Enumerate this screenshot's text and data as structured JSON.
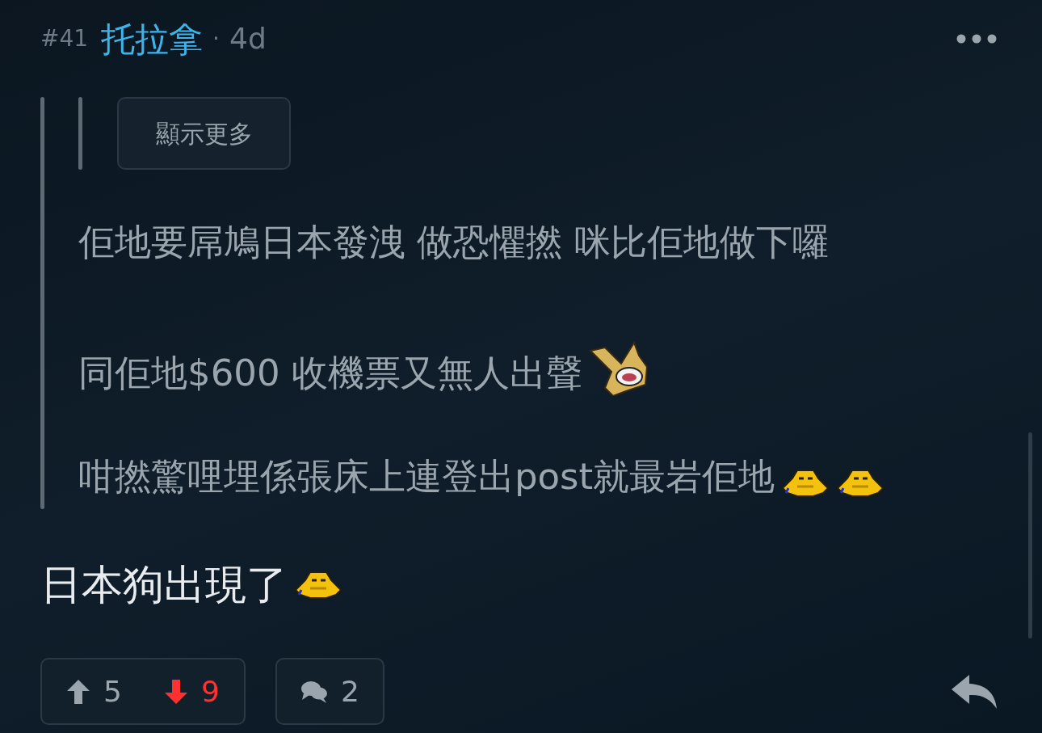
{
  "post": {
    "number": "#41",
    "author": "托拉拿",
    "separator": "·",
    "age": "4d"
  },
  "quote": {
    "show_more": "顯示更多",
    "lines": [
      {
        "text": "佢地要屌鳩日本發洩 做恐懼撚 咪比佢地做下囉"
      },
      {
        "text": "同佢地$600 收機票又無人出聲",
        "stickers": [
          {
            "kind": "horn"
          }
        ]
      },
      {
        "text": "咁撚驚哩埋係張床上連登出post就最岩佢地",
        "stickers": [
          {
            "kind": "cry"
          },
          {
            "kind": "cry"
          }
        ]
      }
    ]
  },
  "body": {
    "text": "日本狗出現了",
    "stickers": [
      {
        "kind": "cry"
      }
    ]
  },
  "footer": {
    "upvotes": "5",
    "upvote_selected": false,
    "downvotes": "9",
    "downvote_selected": true,
    "comments": "2"
  }
}
